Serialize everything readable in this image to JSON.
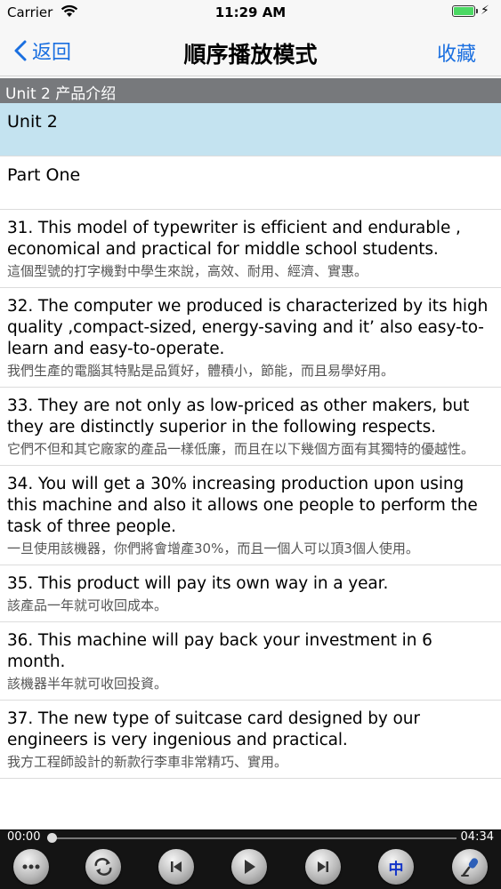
{
  "status_bar": {
    "carrier": "Carrier",
    "time": "11:29 AM"
  },
  "nav": {
    "back_label": "返回",
    "title": "順序播放模式",
    "right_label": "收藏"
  },
  "section_header": "Unit 2 产品介绍",
  "rows": [
    {
      "type": "simple",
      "text": "Unit 2",
      "selected": true
    },
    {
      "type": "simple",
      "text": "Part One",
      "selected": false
    },
    {
      "type": "sentence",
      "en": "31. This model of typewriter is efficient and endurable , economical and practical for middle school students.",
      "zh": "這個型號的打字機對中學生來說，高效、耐用、經濟、實惠。"
    },
    {
      "type": "sentence",
      "en": "32. The computer we produced is characterized by its high quality ,compact-sized, energy-saving and it’ also easy-to-learn and easy-to-operate.",
      "zh": "我們生產的電腦其特點是品質好，體積小，節能，而且易學好用。"
    },
    {
      "type": "sentence",
      "en": "33. They are not only as low-priced as other makers, but they are distinctly superior in the following respects.",
      "zh": "它們不但和其它廠家的產品一樣低廉，而且在以下幾個方面有其獨特的優越性。"
    },
    {
      "type": "sentence",
      "en": "34. You will get a 30% increasing production upon using this machine and also it allows one people to perform the task of three people.",
      "zh": "一旦使用該機器，你們將會增產30%，而且一個人可以頂3個人使用。"
    },
    {
      "type": "sentence",
      "en": "35. This product will pay its own way in a year.",
      "zh": "該產品一年就可收回成本。"
    },
    {
      "type": "sentence",
      "en": "36. This machine will pay back your investment in 6 month.",
      "zh": "該機器半年就可收回投資。"
    },
    {
      "type": "sentence",
      "en": "37. The new type of suitcase card designed by our engineers is very ingenious and practical.",
      "zh": "我方工程師設計的新款行李車非常精巧、實用。"
    }
  ],
  "player": {
    "current_time": "00:00",
    "total_time": "04:34",
    "progress_fraction": 0.0,
    "lang_label": "中",
    "buttons": [
      "more-icon",
      "loop-icon",
      "previous-icon",
      "play-icon",
      "next-icon",
      "language-toggle",
      "microphone-icon"
    ]
  },
  "colors": {
    "accent": "#1a6fe0",
    "selected_row": "#c4e3f0",
    "section_header": "#77797c",
    "player_bg": "#141414"
  }
}
